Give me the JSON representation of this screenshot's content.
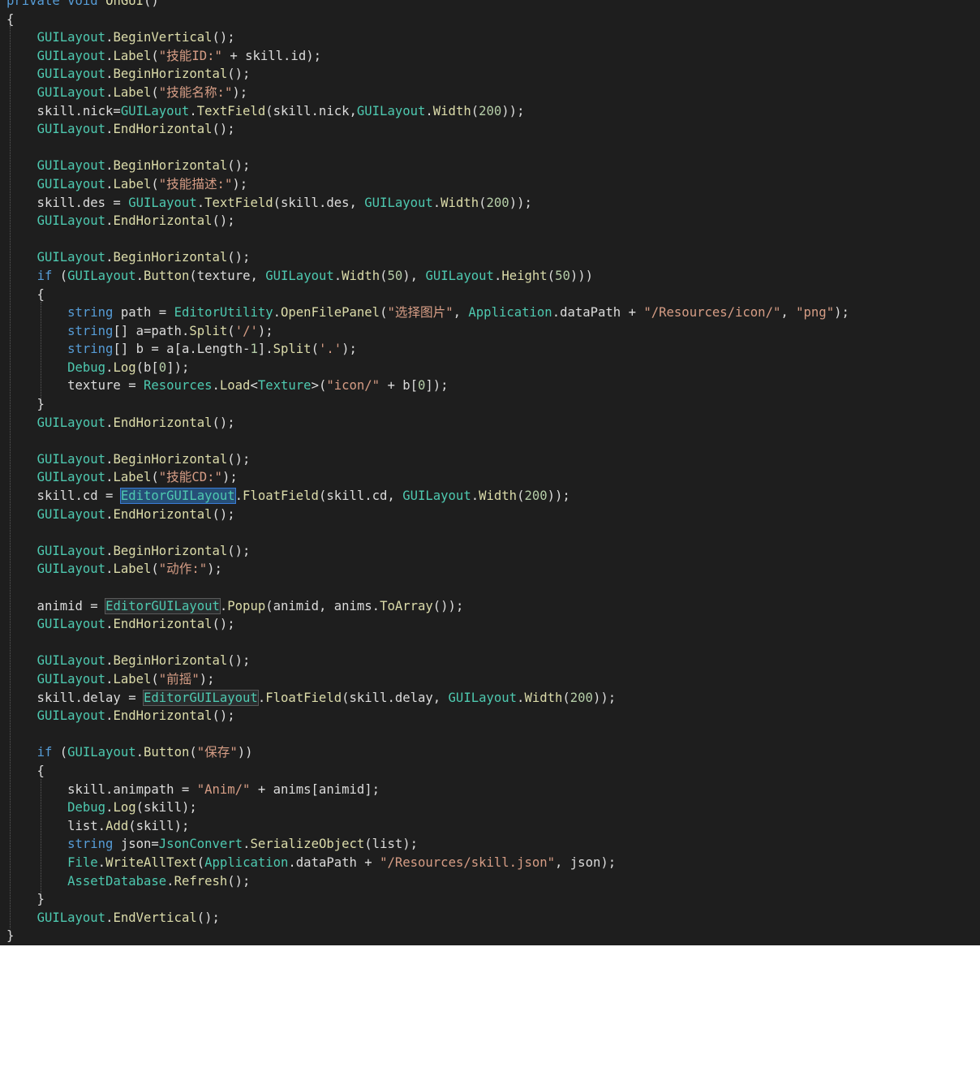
{
  "colors": {
    "background": "#1e1e1e",
    "keyword": "#569cd6",
    "type": "#4ec9b0",
    "method": "#dcdcaa",
    "string": "#d69d85",
    "number": "#b5cea8",
    "default": "#dcdcdc"
  },
  "lines": [
    [
      [
        "k",
        "private "
      ],
      [
        "k",
        "void "
      ],
      [
        "m",
        "OnGUI"
      ],
      [
        "p",
        "()"
      ]
    ],
    [
      [
        "p",
        "{"
      ]
    ],
    [
      [
        "p",
        "    "
      ],
      [
        "t",
        "GUILayout"
      ],
      [
        "p",
        "."
      ],
      [
        "m",
        "BeginVertical"
      ],
      [
        "p",
        "();"
      ]
    ],
    [
      [
        "p",
        "    "
      ],
      [
        "t",
        "GUILayout"
      ],
      [
        "p",
        "."
      ],
      [
        "m",
        "Label"
      ],
      [
        "p",
        "("
      ],
      [
        "s",
        "\"技能ID:\""
      ],
      [
        "p",
        " + skill.id);"
      ]
    ],
    [
      [
        "p",
        "    "
      ],
      [
        "t",
        "GUILayout"
      ],
      [
        "p",
        "."
      ],
      [
        "m",
        "BeginHorizontal"
      ],
      [
        "p",
        "();"
      ]
    ],
    [
      [
        "p",
        "    "
      ],
      [
        "t",
        "GUILayout"
      ],
      [
        "p",
        "."
      ],
      [
        "m",
        "Label"
      ],
      [
        "p",
        "("
      ],
      [
        "s",
        "\"技能名称:\""
      ],
      [
        "p",
        ");"
      ]
    ],
    [
      [
        "p",
        "    skill.nick="
      ],
      [
        "t",
        "GUILayout"
      ],
      [
        "p",
        "."
      ],
      [
        "m",
        "TextField"
      ],
      [
        "p",
        "(skill.nick,"
      ],
      [
        "t",
        "GUILayout"
      ],
      [
        "p",
        "."
      ],
      [
        "m",
        "Width"
      ],
      [
        "p",
        "("
      ],
      [
        "n",
        "200"
      ],
      [
        "p",
        "));"
      ]
    ],
    [
      [
        "p",
        "    "
      ],
      [
        "t",
        "GUILayout"
      ],
      [
        "p",
        "."
      ],
      [
        "m",
        "EndHorizontal"
      ],
      [
        "p",
        "();"
      ]
    ],
    [],
    [
      [
        "p",
        "    "
      ],
      [
        "t",
        "GUILayout"
      ],
      [
        "p",
        "."
      ],
      [
        "m",
        "BeginHorizontal"
      ],
      [
        "p",
        "();"
      ]
    ],
    [
      [
        "p",
        "    "
      ],
      [
        "t",
        "GUILayout"
      ],
      [
        "p",
        "."
      ],
      [
        "m",
        "Label"
      ],
      [
        "p",
        "("
      ],
      [
        "s",
        "\"技能描述:\""
      ],
      [
        "p",
        ");"
      ]
    ],
    [
      [
        "p",
        "    skill.des = "
      ],
      [
        "t",
        "GUILayout"
      ],
      [
        "p",
        "."
      ],
      [
        "m",
        "TextField"
      ],
      [
        "p",
        "(skill.des, "
      ],
      [
        "t",
        "GUILayout"
      ],
      [
        "p",
        "."
      ],
      [
        "m",
        "Width"
      ],
      [
        "p",
        "("
      ],
      [
        "n",
        "200"
      ],
      [
        "p",
        "));"
      ]
    ],
    [
      [
        "p",
        "    "
      ],
      [
        "t",
        "GUILayout"
      ],
      [
        "p",
        "."
      ],
      [
        "m",
        "EndHorizontal"
      ],
      [
        "p",
        "();"
      ]
    ],
    [],
    [
      [
        "p",
        "    "
      ],
      [
        "t",
        "GUILayout"
      ],
      [
        "p",
        "."
      ],
      [
        "m",
        "BeginHorizontal"
      ],
      [
        "p",
        "();"
      ]
    ],
    [
      [
        "p",
        "    "
      ],
      [
        "k",
        "if"
      ],
      [
        "p",
        " ("
      ],
      [
        "t",
        "GUILayout"
      ],
      [
        "p",
        "."
      ],
      [
        "m",
        "Button"
      ],
      [
        "p",
        "(texture, "
      ],
      [
        "t",
        "GUILayout"
      ],
      [
        "p",
        "."
      ],
      [
        "m",
        "Width"
      ],
      [
        "p",
        "("
      ],
      [
        "n",
        "50"
      ],
      [
        "p",
        "), "
      ],
      [
        "t",
        "GUILayout"
      ],
      [
        "p",
        "."
      ],
      [
        "m",
        "Height"
      ],
      [
        "p",
        "("
      ],
      [
        "n",
        "50"
      ],
      [
        "p",
        ")))"
      ]
    ],
    [
      [
        "p",
        "    {"
      ]
    ],
    [
      [
        "p",
        "        "
      ],
      [
        "k",
        "string"
      ],
      [
        "p",
        " path = "
      ],
      [
        "t",
        "EditorUtility"
      ],
      [
        "p",
        "."
      ],
      [
        "m",
        "OpenFilePanel"
      ],
      [
        "p",
        "("
      ],
      [
        "s",
        "\"选择图片\""
      ],
      [
        "p",
        ", "
      ],
      [
        "t",
        "Application"
      ],
      [
        "p",
        ".dataPath + "
      ],
      [
        "s",
        "\"/Resources/icon/\""
      ],
      [
        "p",
        ", "
      ],
      [
        "s",
        "\"png\""
      ],
      [
        "p",
        ");"
      ]
    ],
    [
      [
        "p",
        "        "
      ],
      [
        "k",
        "string"
      ],
      [
        "p",
        "[] a=path."
      ],
      [
        "m",
        "Split"
      ],
      [
        "p",
        "("
      ],
      [
        "s",
        "'/'"
      ],
      [
        "p",
        ");"
      ]
    ],
    [
      [
        "p",
        "        "
      ],
      [
        "k",
        "string"
      ],
      [
        "p",
        "[] b = a[a.Length-"
      ],
      [
        "n",
        "1"
      ],
      [
        "p",
        "]."
      ],
      [
        "m",
        "Split"
      ],
      [
        "p",
        "("
      ],
      [
        "s",
        "'.'"
      ],
      [
        "p",
        ");"
      ]
    ],
    [
      [
        "p",
        "        "
      ],
      [
        "t",
        "Debug"
      ],
      [
        "p",
        "."
      ],
      [
        "m",
        "Log"
      ],
      [
        "p",
        "(b["
      ],
      [
        "n",
        "0"
      ],
      [
        "p",
        "]);"
      ]
    ],
    [
      [
        "p",
        "        texture = "
      ],
      [
        "t",
        "Resources"
      ],
      [
        "p",
        "."
      ],
      [
        "m",
        "Load"
      ],
      [
        "p",
        "<"
      ],
      [
        "t",
        "Texture"
      ],
      [
        "p",
        ">("
      ],
      [
        "s",
        "\"icon/\""
      ],
      [
        "p",
        " + b["
      ],
      [
        "n",
        "0"
      ],
      [
        "p",
        "]);"
      ]
    ],
    [
      [
        "p",
        "    }"
      ]
    ],
    [
      [
        "p",
        "    "
      ],
      [
        "t",
        "GUILayout"
      ],
      [
        "p",
        "."
      ],
      [
        "m",
        "EndHorizontal"
      ],
      [
        "p",
        "();"
      ]
    ],
    [],
    [
      [
        "p",
        "    "
      ],
      [
        "t",
        "GUILayout"
      ],
      [
        "p",
        "."
      ],
      [
        "m",
        "BeginHorizontal"
      ],
      [
        "p",
        "();"
      ]
    ],
    [
      [
        "p",
        "    "
      ],
      [
        "t",
        "GUILayout"
      ],
      [
        "p",
        "."
      ],
      [
        "m",
        "Label"
      ],
      [
        "p",
        "("
      ],
      [
        "s",
        "\"技能CD:\""
      ],
      [
        "p",
        ");"
      ]
    ],
    [
      [
        "p",
        "    skill.cd = "
      ],
      [
        "th",
        "EditorGUILayout"
      ],
      [
        "p",
        "."
      ],
      [
        "m",
        "FloatField"
      ],
      [
        "p",
        "(skill.cd, "
      ],
      [
        "t",
        "GUILayout"
      ],
      [
        "p",
        "."
      ],
      [
        "m",
        "Width"
      ],
      [
        "p",
        "("
      ],
      [
        "n",
        "200"
      ],
      [
        "p",
        "));"
      ]
    ],
    [
      [
        "p",
        "    "
      ],
      [
        "t",
        "GUILayout"
      ],
      [
        "p",
        "."
      ],
      [
        "m",
        "EndHorizontal"
      ],
      [
        "p",
        "();"
      ]
    ],
    [],
    [
      [
        "p",
        "    "
      ],
      [
        "t",
        "GUILayout"
      ],
      [
        "p",
        "."
      ],
      [
        "m",
        "BeginHorizontal"
      ],
      [
        "p",
        "();"
      ]
    ],
    [
      [
        "p",
        "    "
      ],
      [
        "t",
        "GUILayout"
      ],
      [
        "p",
        "."
      ],
      [
        "m",
        "Label"
      ],
      [
        "p",
        "("
      ],
      [
        "s",
        "\"动作:\""
      ],
      [
        "p",
        ");"
      ]
    ],
    [],
    [
      [
        "p",
        "    animid = "
      ],
      [
        "tr",
        "EditorGUILayout"
      ],
      [
        "p",
        "."
      ],
      [
        "m",
        "Popup"
      ],
      [
        "p",
        "(animid, anims."
      ],
      [
        "m",
        "ToArray"
      ],
      [
        "p",
        "());"
      ]
    ],
    [
      [
        "p",
        "    "
      ],
      [
        "t",
        "GUILayout"
      ],
      [
        "p",
        "."
      ],
      [
        "m",
        "EndHorizontal"
      ],
      [
        "p",
        "();"
      ]
    ],
    [],
    [
      [
        "p",
        "    "
      ],
      [
        "t",
        "GUILayout"
      ],
      [
        "p",
        "."
      ],
      [
        "m",
        "BeginHorizontal"
      ],
      [
        "p",
        "();"
      ]
    ],
    [
      [
        "p",
        "    "
      ],
      [
        "t",
        "GUILayout"
      ],
      [
        "p",
        "."
      ],
      [
        "m",
        "Label"
      ],
      [
        "p",
        "("
      ],
      [
        "s",
        "\"前摇\""
      ],
      [
        "p",
        ");"
      ]
    ],
    [
      [
        "p",
        "    skill.delay = "
      ],
      [
        "tr",
        "EditorGUILayout"
      ],
      [
        "p",
        "."
      ],
      [
        "m",
        "FloatField"
      ],
      [
        "p",
        "(skill.delay, "
      ],
      [
        "t",
        "GUILayout"
      ],
      [
        "p",
        "."
      ],
      [
        "m",
        "Width"
      ],
      [
        "p",
        "("
      ],
      [
        "n",
        "200"
      ],
      [
        "p",
        "));"
      ]
    ],
    [
      [
        "p",
        "    "
      ],
      [
        "t",
        "GUILayout"
      ],
      [
        "p",
        "."
      ],
      [
        "m",
        "EndHorizontal"
      ],
      [
        "p",
        "();"
      ]
    ],
    [],
    [
      [
        "p",
        "    "
      ],
      [
        "k",
        "if"
      ],
      [
        "p",
        " ("
      ],
      [
        "t",
        "GUILayout"
      ],
      [
        "p",
        "."
      ],
      [
        "m",
        "Button"
      ],
      [
        "p",
        "("
      ],
      [
        "s",
        "\"保存\""
      ],
      [
        "p",
        "))"
      ]
    ],
    [
      [
        "p",
        "    {"
      ]
    ],
    [
      [
        "p",
        "        skill.animpath = "
      ],
      [
        "s",
        "\"Anim/\""
      ],
      [
        "p",
        " + anims[animid];"
      ]
    ],
    [
      [
        "p",
        "        "
      ],
      [
        "t",
        "Debug"
      ],
      [
        "p",
        "."
      ],
      [
        "m",
        "Log"
      ],
      [
        "p",
        "(skill);"
      ]
    ],
    [
      [
        "p",
        "        list."
      ],
      [
        "m",
        "Add"
      ],
      [
        "p",
        "(skill);"
      ]
    ],
    [
      [
        "p",
        "        "
      ],
      [
        "k",
        "string"
      ],
      [
        "p",
        " json="
      ],
      [
        "t",
        "JsonConvert"
      ],
      [
        "p",
        "."
      ],
      [
        "m",
        "SerializeObject"
      ],
      [
        "p",
        "(list);"
      ]
    ],
    [
      [
        "p",
        "        "
      ],
      [
        "t",
        "File"
      ],
      [
        "p",
        "."
      ],
      [
        "m",
        "WriteAllText"
      ],
      [
        "p",
        "("
      ],
      [
        "t",
        "Application"
      ],
      [
        "p",
        ".dataPath + "
      ],
      [
        "s",
        "\"/Resources/skill.json\""
      ],
      [
        "p",
        ", json);"
      ]
    ],
    [
      [
        "p",
        "        "
      ],
      [
        "t",
        "AssetDatabase"
      ],
      [
        "p",
        "."
      ],
      [
        "m",
        "Refresh"
      ],
      [
        "p",
        "();"
      ]
    ],
    [
      [
        "p",
        "    }"
      ]
    ],
    [
      [
        "p",
        "    "
      ],
      [
        "t",
        "GUILayout"
      ],
      [
        "p",
        "."
      ],
      [
        "m",
        "EndVertical"
      ],
      [
        "p",
        "();"
      ]
    ],
    [
      [
        "p",
        "}"
      ]
    ]
  ]
}
